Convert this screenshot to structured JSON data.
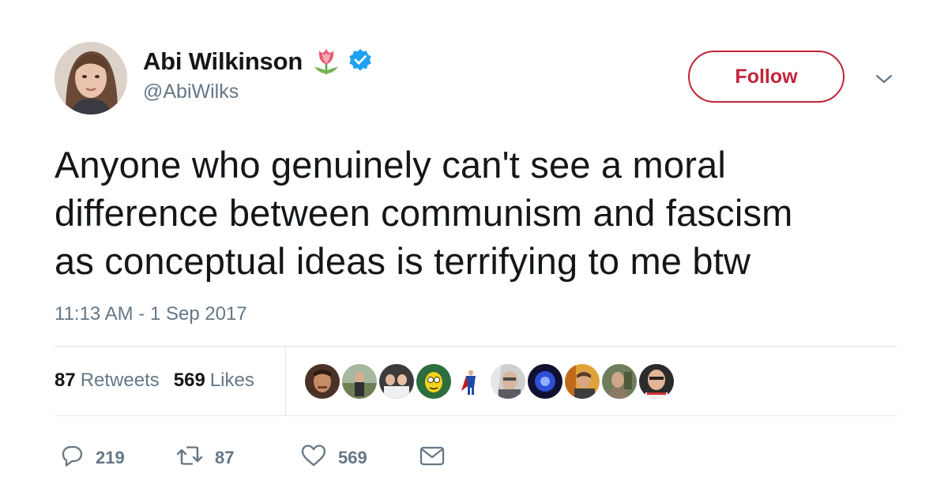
{
  "author": {
    "display_name": "Abi Wilkinson",
    "handle": "@AbiWilks",
    "emoji_icon": "tulip-emoji",
    "verified_icon": "verified-badge-icon",
    "verified_color": "#1da1f2"
  },
  "follow_button": {
    "label": "Follow",
    "color": "#c1243a"
  },
  "tweet": {
    "text": "Anyone who genuinely can't see a moral\ndifference between communism and fascism\nas conceptual ideas is terrifying to me btw",
    "timestamp": "11:13 AM - 1 Sep 2017"
  },
  "stats": {
    "retweets_count": "87",
    "retweets_label": "Retweets",
    "likes_count": "569",
    "likes_label": "Likes"
  },
  "liker_avatars_count_shown": 10,
  "actions": {
    "reply_count": "219",
    "retweet_count": "87",
    "like_count": "569"
  },
  "colors": {
    "text_primary": "#14171a",
    "text_secondary": "#657786",
    "divider": "#e1e8ed"
  }
}
